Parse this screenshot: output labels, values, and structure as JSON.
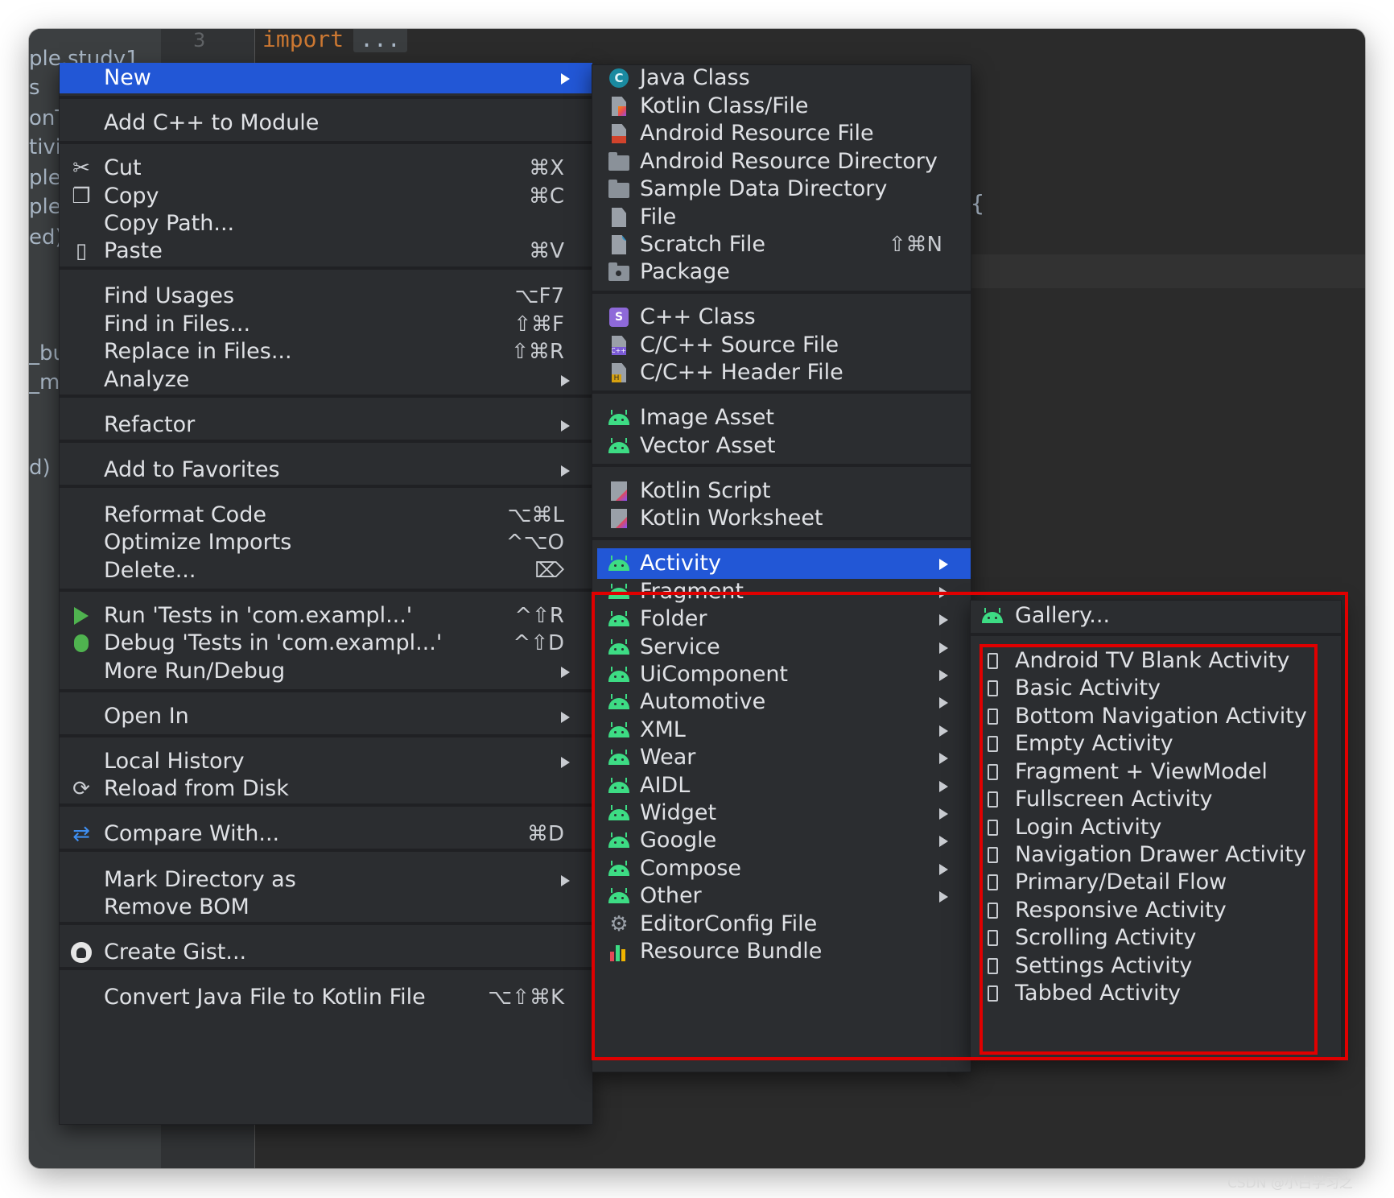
{
  "editor": {
    "line_number": "3",
    "code_keyword": "import",
    "code_fold": "...",
    "code_brace": "{",
    "project_stubs": [
      "ple.study1",
      "s",
      "onTe",
      "tivit",
      "ple.",
      "ple.",
      "ed)",
      "_bu",
      "_ma",
      "d)"
    ]
  },
  "context_menu": {
    "items": [
      {
        "label": "New",
        "shortcut": "",
        "submenu": true,
        "icon": "none",
        "highlighted": true
      },
      {
        "label": "Add C++ to Module",
        "shortcut": "",
        "submenu": false,
        "icon": "none"
      },
      {
        "label": "Cut",
        "shortcut": "⌘X",
        "submenu": false,
        "icon": "scissors-icon"
      },
      {
        "label": "Copy",
        "shortcut": "⌘C",
        "submenu": false,
        "icon": "copy-icon"
      },
      {
        "label": "Copy Path...",
        "shortcut": "",
        "submenu": false,
        "icon": "none"
      },
      {
        "label": "Paste",
        "shortcut": "⌘V",
        "submenu": false,
        "icon": "paste-icon"
      },
      {
        "label": "Find Usages",
        "shortcut": "⌥F7",
        "submenu": false,
        "icon": "none"
      },
      {
        "label": "Find in Files...",
        "shortcut": "⇧⌘F",
        "submenu": false,
        "icon": "none"
      },
      {
        "label": "Replace in Files...",
        "shortcut": "⇧⌘R",
        "submenu": false,
        "icon": "none"
      },
      {
        "label": "Analyze",
        "shortcut": "",
        "submenu": true,
        "icon": "none"
      },
      {
        "label": "Refactor",
        "shortcut": "",
        "submenu": true,
        "icon": "none"
      },
      {
        "label": "Add to Favorites",
        "shortcut": "",
        "submenu": true,
        "icon": "none"
      },
      {
        "label": "Reformat Code",
        "shortcut": "⌥⌘L",
        "submenu": false,
        "icon": "none"
      },
      {
        "label": "Optimize Imports",
        "shortcut": "^⌥O",
        "submenu": false,
        "icon": "none"
      },
      {
        "label": "Delete...",
        "shortcut": "⌦",
        "submenu": false,
        "icon": "none"
      },
      {
        "label": "Run 'Tests in 'com.exampl...'",
        "shortcut": "^⇧R",
        "submenu": false,
        "icon": "run-icon"
      },
      {
        "label": "Debug 'Tests in 'com.exampl...'",
        "shortcut": "^⇧D",
        "submenu": false,
        "icon": "debug-icon"
      },
      {
        "label": "More Run/Debug",
        "shortcut": "",
        "submenu": true,
        "icon": "none"
      },
      {
        "label": "Open In",
        "shortcut": "",
        "submenu": true,
        "icon": "none"
      },
      {
        "label": "Local History",
        "shortcut": "",
        "submenu": true,
        "icon": "none"
      },
      {
        "label": "Reload from Disk",
        "shortcut": "",
        "submenu": false,
        "icon": "reload-icon"
      },
      {
        "label": "Compare With...",
        "shortcut": "⌘D",
        "submenu": false,
        "icon": "compare-icon"
      },
      {
        "label": "Mark Directory as",
        "shortcut": "",
        "submenu": true,
        "icon": "none"
      },
      {
        "label": "Remove BOM",
        "shortcut": "",
        "submenu": false,
        "icon": "none"
      },
      {
        "label": "Create Gist...",
        "shortcut": "",
        "submenu": false,
        "icon": "github-icon"
      },
      {
        "label": "Convert Java File to Kotlin File",
        "shortcut": "⌥⇧⌘K",
        "submenu": false,
        "icon": "none"
      }
    ]
  },
  "new_submenu": {
    "items": [
      {
        "label": "Java Class",
        "shortcut": "",
        "submenu": false,
        "icon": "java-class-icon"
      },
      {
        "label": "Kotlin Class/File",
        "shortcut": "",
        "submenu": false,
        "icon": "kotlin-file-icon"
      },
      {
        "label": "Android Resource File",
        "shortcut": "",
        "submenu": false,
        "icon": "resource-file-icon"
      },
      {
        "label": "Android Resource Directory",
        "shortcut": "",
        "submenu": false,
        "icon": "folder-icon"
      },
      {
        "label": "Sample Data Directory",
        "shortcut": "",
        "submenu": false,
        "icon": "folder-icon"
      },
      {
        "label": "File",
        "shortcut": "",
        "submenu": false,
        "icon": "file-icon"
      },
      {
        "label": "Scratch File",
        "shortcut": "⇧⌘N",
        "submenu": false,
        "icon": "scratch-file-icon"
      },
      {
        "label": "Package",
        "shortcut": "",
        "submenu": false,
        "icon": "package-icon"
      },
      {
        "label": "C++ Class",
        "shortcut": "",
        "submenu": false,
        "icon": "cpp-class-icon"
      },
      {
        "label": "C/C++ Source File",
        "shortcut": "",
        "submenu": false,
        "icon": "cpp-source-icon"
      },
      {
        "label": "C/C++ Header File",
        "shortcut": "",
        "submenu": false,
        "icon": "cpp-header-icon"
      },
      {
        "label": "Image Asset",
        "shortcut": "",
        "submenu": false,
        "icon": "android-icon"
      },
      {
        "label": "Vector Asset",
        "shortcut": "",
        "submenu": false,
        "icon": "android-icon"
      },
      {
        "label": "Kotlin Script",
        "shortcut": "",
        "submenu": false,
        "icon": "kotlin-script-icon"
      },
      {
        "label": "Kotlin Worksheet",
        "shortcut": "",
        "submenu": false,
        "icon": "kotlin-script-icon"
      },
      {
        "label": "Activity",
        "shortcut": "",
        "submenu": true,
        "icon": "android-icon",
        "highlighted": true
      },
      {
        "label": "Fragment",
        "shortcut": "",
        "submenu": true,
        "icon": "android-icon"
      },
      {
        "label": "Folder",
        "shortcut": "",
        "submenu": true,
        "icon": "android-icon"
      },
      {
        "label": "Service",
        "shortcut": "",
        "submenu": true,
        "icon": "android-icon"
      },
      {
        "label": "UiComponent",
        "shortcut": "",
        "submenu": true,
        "icon": "android-icon"
      },
      {
        "label": "Automotive",
        "shortcut": "",
        "submenu": true,
        "icon": "android-icon"
      },
      {
        "label": "XML",
        "shortcut": "",
        "submenu": true,
        "icon": "android-icon"
      },
      {
        "label": "Wear",
        "shortcut": "",
        "submenu": true,
        "icon": "android-icon"
      },
      {
        "label": "AIDL",
        "shortcut": "",
        "submenu": true,
        "icon": "android-icon"
      },
      {
        "label": "Widget",
        "shortcut": "",
        "submenu": true,
        "icon": "android-icon"
      },
      {
        "label": "Google",
        "shortcut": "",
        "submenu": true,
        "icon": "android-icon"
      },
      {
        "label": "Compose",
        "shortcut": "",
        "submenu": true,
        "icon": "android-icon"
      },
      {
        "label": "Other",
        "shortcut": "",
        "submenu": true,
        "icon": "android-icon"
      },
      {
        "label": "EditorConfig File",
        "shortcut": "",
        "submenu": false,
        "icon": "gear-icon"
      },
      {
        "label": "Resource Bundle",
        "shortcut": "",
        "submenu": false,
        "icon": "resource-bundle-icon"
      }
    ]
  },
  "activity_submenu": {
    "items": [
      {
        "label": "Gallery...",
        "icon": "android-icon"
      },
      {
        "label": "Android TV Blank Activity",
        "icon": "template-icon"
      },
      {
        "label": "Basic Activity",
        "icon": "template-icon"
      },
      {
        "label": "Bottom Navigation Activity",
        "icon": "template-icon"
      },
      {
        "label": "Empty Activity",
        "icon": "template-icon"
      },
      {
        "label": "Fragment + ViewModel",
        "icon": "template-icon"
      },
      {
        "label": "Fullscreen Activity",
        "icon": "template-icon"
      },
      {
        "label": "Login Activity",
        "icon": "template-icon"
      },
      {
        "label": "Navigation Drawer Activity",
        "icon": "template-icon"
      },
      {
        "label": "Primary/Detail Flow",
        "icon": "template-icon"
      },
      {
        "label": "Responsive Activity",
        "icon": "template-icon"
      },
      {
        "label": "Scrolling Activity",
        "icon": "template-icon"
      },
      {
        "label": "Settings Activity",
        "icon": "template-icon"
      },
      {
        "label": "Tabbed Activity",
        "icon": "template-icon"
      }
    ]
  },
  "colors": {
    "highlight": "#2257d6",
    "annotation_red": "#e00000",
    "android_green": "#3ddc84"
  },
  "watermark": "CSDN @小白学习之"
}
